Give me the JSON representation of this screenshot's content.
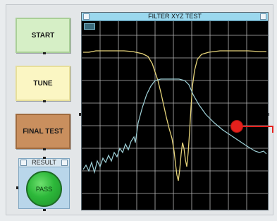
{
  "controls": {
    "start_label": "START",
    "tune_label": "TUNE",
    "final_test_label": "FINAL TEST"
  },
  "result": {
    "title": "RESULT",
    "status": "PASS",
    "status_color": "#2db83a"
  },
  "scope": {
    "title": "FILTER XYZ TEST",
    "grid": true,
    "trace_colors": [
      "#e6d47a",
      "#9fd1d8"
    ]
  },
  "marker": {
    "color": "#e5201c"
  }
}
